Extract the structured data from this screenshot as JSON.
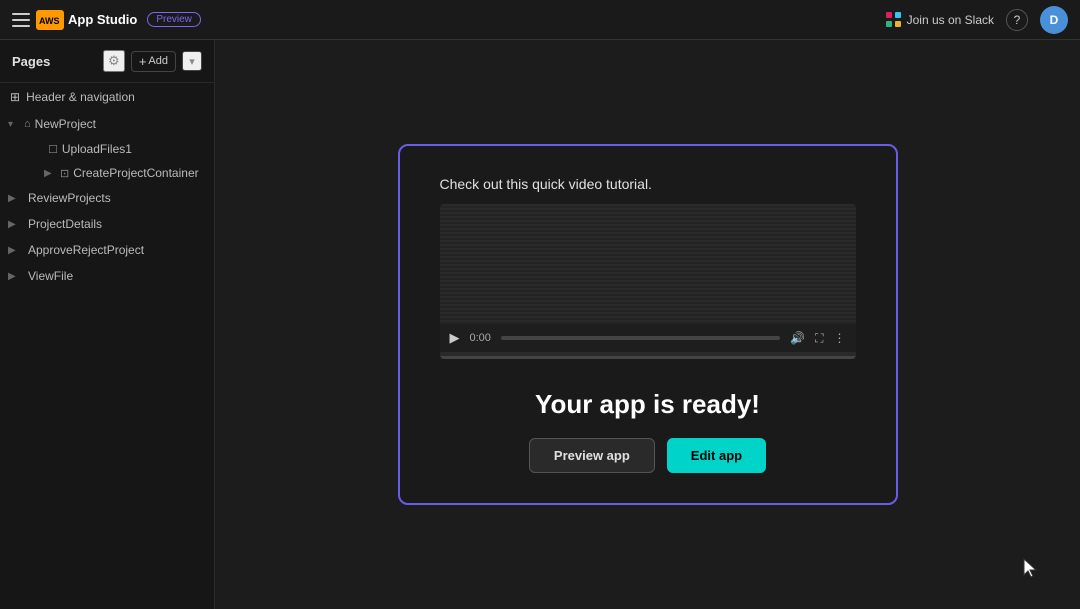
{
  "topnav": {
    "hamburger_label": "menu",
    "aws_logo": "AWS",
    "app_name": "App Studio",
    "preview_badge": "Preview",
    "slack_label": "Join us on Slack",
    "help_label": "?",
    "avatar_label": "D"
  },
  "sidebar": {
    "title": "Pages",
    "gear_icon": "⚙",
    "add_label": "Add",
    "add_plus": "+",
    "chevron_icon": "▾",
    "items": [
      {
        "label": "Header & navigation",
        "icon": "⊞",
        "indent": 0
      },
      {
        "label": "NewProject",
        "icon": "⌂",
        "indent": 0,
        "expandable": true,
        "expanded": true
      },
      {
        "label": "UploadFiles1",
        "icon": "☐",
        "indent": 1
      },
      {
        "label": "CreateProjectContainer",
        "icon": "⊡",
        "indent": 2,
        "expandable": true
      },
      {
        "label": "ReviewProjects",
        "icon": "",
        "indent": 0,
        "expandable": true
      },
      {
        "label": "ProjectDetails",
        "icon": "",
        "indent": 0,
        "expandable": true
      },
      {
        "label": "ApproveRejectProject",
        "icon": "",
        "indent": 0,
        "expandable": true
      },
      {
        "label": "ViewFile",
        "icon": "",
        "indent": 0,
        "expandable": true
      }
    ]
  },
  "modal": {
    "tutorial_text": "Check out this quick video tutorial.",
    "video_time": "0:00",
    "ready_title": "Your app is ready!",
    "preview_btn": "Preview app",
    "edit_btn": "Edit app"
  }
}
